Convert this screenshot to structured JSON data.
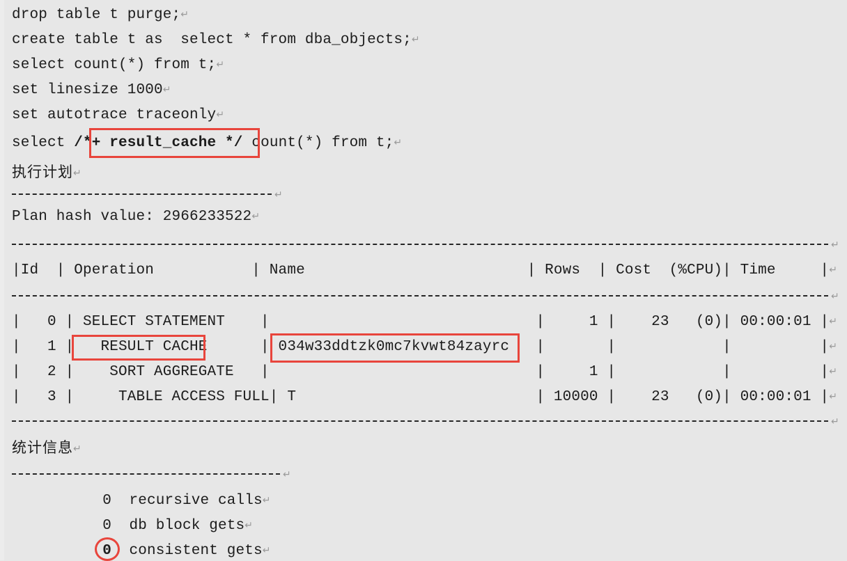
{
  "document": {
    "background_color": "#e7e7e7",
    "text_color": "#1c1c1c",
    "annotation_color": "#e8453c",
    "pilcrow_glyph": "↵"
  },
  "sql_script": [
    {
      "text": "drop table t purge;"
    },
    {
      "text": "create table t as  select * from dba_objects;"
    },
    {
      "text": "select count(*) from t;"
    },
    {
      "text": "set linesize 1000"
    },
    {
      "text": "set autotrace traceonly"
    }
  ],
  "hinted_query": {
    "prefix": "select ",
    "hint": "/*+ result_cache */",
    "suffix": " count(*) from t;"
  },
  "sections": {
    "execution_plan_heading": "执行计划",
    "statistics_heading": "统计信息"
  },
  "plan": {
    "hash_label": "Plan hash value: 2966233522",
    "columns": [
      "Id",
      "Operation",
      "Name",
      "Rows",
      "Cost  (%CPU)",
      "Time"
    ],
    "header_row": "|Id  | Operation           | Name                         | Rows  | Cost  (%CPU)| Time     |",
    "rows": [
      {
        "id": "0",
        "operation": "SELECT STATEMENT",
        "name": "",
        "rows": "1",
        "cost": "23",
        "cpu": "(0)",
        "time": "00:00:01",
        "raw": "|   0 | SELECT STATEMENT    |                              |     1 |    23   (0)| 00:00:01 |"
      },
      {
        "id": "1",
        "operation": "RESULT CACHE",
        "name": "034w33ddtzk0mc7kvwt84zayrc",
        "rows": "",
        "cost": "",
        "cpu": "",
        "time": "",
        "raw": "|   1 |   RESULT CACHE      | 034w33ddtzk0mc7kvwt84zayrc   |       |            |          |"
      },
      {
        "id": "2",
        "operation": "SORT AGGREGATE",
        "name": "",
        "rows": "1",
        "cost": "",
        "cpu": "",
        "time": "",
        "raw": "|   2 |    SORT AGGREGATE   |                              |     1 |            |          |"
      },
      {
        "id": "3",
        "operation": "TABLE ACCESS FULL",
        "name": "T",
        "rows": "10000",
        "cost": "23",
        "cpu": "(0)",
        "time": "00:00:01",
        "raw": "|   3 |     TABLE ACCESS FULL| T                           | 10000 |    23   (0)| 00:00:01 |"
      }
    ]
  },
  "statistics": [
    {
      "value": "0",
      "label": "recursive calls"
    },
    {
      "value": "0",
      "label": "db block gets"
    },
    {
      "value": "0",
      "label": "consistent gets"
    }
  ],
  "annotations": [
    {
      "kind": "box",
      "target": "result_cache_hint",
      "label": "/*+ result_cache */"
    },
    {
      "kind": "box",
      "target": "result_cache_operation",
      "label": "RESULT CACHE"
    },
    {
      "kind": "box",
      "target": "result_cache_name",
      "label": "034w33ddtzk0mc7kvwt84zayrc"
    },
    {
      "kind": "circle",
      "target": "consistent_gets_value",
      "label": "0"
    }
  ]
}
